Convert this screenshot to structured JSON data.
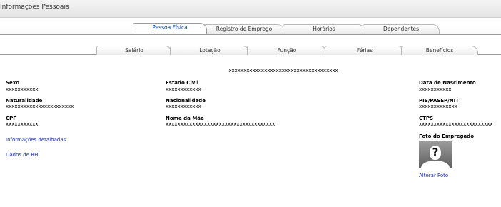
{
  "window": {
    "title": "Informações Pessoais"
  },
  "primary_tabs": [
    {
      "label": "Pessoa Física",
      "active": true
    },
    {
      "label": "Registro de Emprego",
      "active": false
    },
    {
      "label": "Horários",
      "active": false
    },
    {
      "label": "Dependentes",
      "active": false
    }
  ],
  "secondary_tabs": [
    {
      "label": "Salário"
    },
    {
      "label": "Lotação"
    },
    {
      "label": "Função"
    },
    {
      "label": "Férias"
    },
    {
      "label": "Benefícios"
    }
  ],
  "employee": {
    "full_name": "xxxxxxxxxxxxxxxxxxxxxxxxxxxxxxxxxxxxx",
    "fields": {
      "sexo": {
        "label": "Sexo",
        "value": "xxxxxxxxxxx"
      },
      "naturalidade": {
        "label": "Naturalidade",
        "value": "xxxxxxxxxxxxxxxxxxxxxxx"
      },
      "cpf": {
        "label": "CPF",
        "value": "xxxxxxxxxxx"
      },
      "estado_civil": {
        "label": "Estado Civil",
        "value": "xxxxxxxxxxxx"
      },
      "nacionalidade": {
        "label": "Nacionalidade",
        "value": "xxxxxxxxxxxx"
      },
      "nome_mae": {
        "label": "Nome da Mãe",
        "value": "xxxxxxxxxxxxxxxxxxxxxxxxxxxxxxxxxxxxx"
      },
      "data_nascimento": {
        "label": "Data de Nascimento",
        "value": "xxxxxxxxxxx"
      },
      "pis_pasep": {
        "label": "PIS/PASEP/NIT",
        "value": "xxxxxxxxxxxxx"
      },
      "ctps": {
        "label": "CTPS",
        "value": "xxxxxxxxxxxxxxxxxxxxxxxxx"
      }
    },
    "photo_label": "Foto do Empregado",
    "photo_icon_glyph": "?"
  },
  "links": {
    "detalhes": "Informações detalhadas",
    "rh": "Dados de RH",
    "alterar_foto": "Alterar Foto"
  }
}
